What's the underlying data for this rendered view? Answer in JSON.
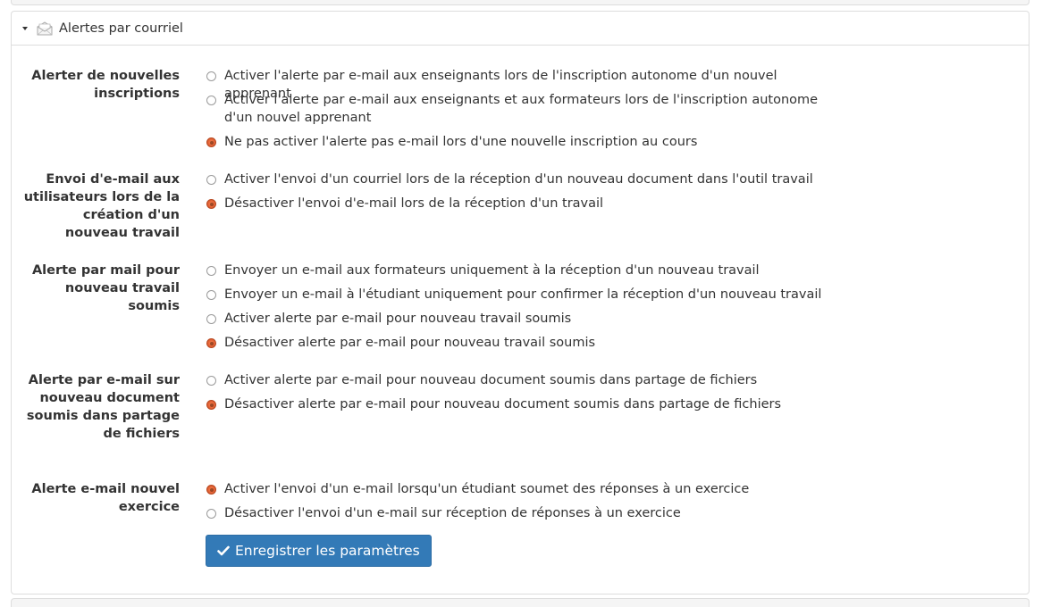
{
  "panel": {
    "title": "Alertes par courriel",
    "save_label": "Enregistrer les paramètres"
  },
  "groups": [
    {
      "label": "Alerter de nouvelles inscriptions",
      "options": [
        {
          "text": "Activer l'alerte par e-mail aux enseignants lors de l'inscription autonome d'un nouvel apprenant",
          "checked": false
        },
        {
          "text": "Activer l'alerte par e-mail aux enseignants et aux formateurs lors de l'inscription autonome d'un nouvel apprenant",
          "checked": false
        },
        {
          "text": "Ne pas activer l'alerte pas e-mail lors d'une nouvelle inscription au cours",
          "checked": true
        }
      ]
    },
    {
      "label": "Envoi d'e-mail aux utilisateurs lors de la création d'un nouveau travail",
      "options": [
        {
          "text": "Activer l'envoi d'un courriel lors de la réception d'un nouveau document dans l'outil travail",
          "checked": false
        },
        {
          "text": "Désactiver l'envoi d'e-mail lors de la réception d'un travail",
          "checked": true
        }
      ]
    },
    {
      "label": "Alerte par mail pour nouveau travail soumis",
      "options": [
        {
          "text": "Envoyer un e-mail aux formateurs uniquement à la réception d'un nouveau travail",
          "checked": false
        },
        {
          "text": "Envoyer un e-mail à l'étudiant uniquement pour confirmer la réception d'un nouveau travail",
          "checked": false
        },
        {
          "text": "Activer alerte par e-mail pour nouveau travail soumis",
          "checked": false
        },
        {
          "text": "Désactiver alerte par e-mail pour nouveau travail soumis",
          "checked": true
        }
      ]
    },
    {
      "label": "Alerte par e-mail sur nouveau document soumis dans partage de fichiers",
      "options": [
        {
          "text": "Activer alerte par e-mail pour nouveau document soumis dans partage de fichiers",
          "checked": false
        },
        {
          "text": "Désactiver alerte par e-mail pour nouveau document soumis dans partage de fichiers",
          "checked": true
        }
      ]
    },
    {
      "label": "Alerte e-mail nouvel exercice",
      "options": [
        {
          "text": "Activer l'envoi d'un e-mail lorsqu'un étudiant soumet des réponses à un exercice",
          "checked": true
        },
        {
          "text": "Désactiver l'envoi d'un e-mail sur réception de réponses à un exercice",
          "checked": false
        }
      ]
    }
  ],
  "colors": {
    "button_bg": "#337ab7",
    "radio_checked": "#e9683a",
    "border": "#dddddd"
  }
}
